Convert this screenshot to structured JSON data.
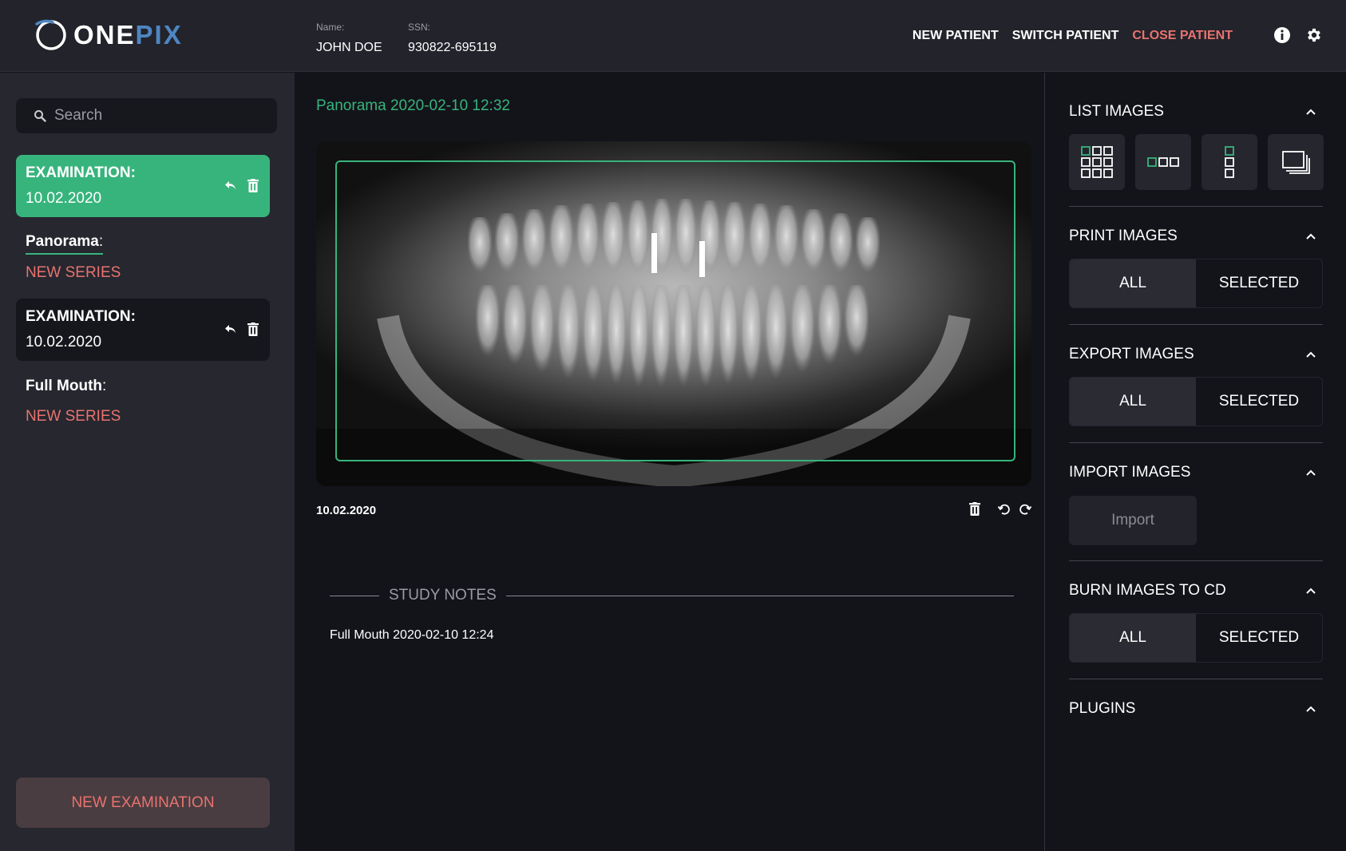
{
  "app": {
    "logo": {
      "one": "ONE",
      "pix": "PIX"
    }
  },
  "patient": {
    "name_label": "Name:",
    "name": "JOHN DOE",
    "ssn_label": "SSN:",
    "ssn": "930822-695119"
  },
  "topnav": {
    "new_patient": "NEW PATIENT",
    "switch_patient": "SWITCH PATIENT",
    "close_patient": "CLOSE PATIENT",
    "info_icon": "info-icon",
    "settings_icon": "gear-icon"
  },
  "sidebar": {
    "search_placeholder": "Search",
    "examinations": [
      {
        "label": "EXAMINATION",
        "date": "10.02.2020",
        "active": true
      },
      {
        "label": "EXAMINATION",
        "date": "10.02.2020",
        "active": false
      }
    ],
    "series": [
      {
        "label": "Panorama",
        "new_series": "NEW SERIES"
      },
      {
        "label": "Full Mouth",
        "new_series": "NEW SERIES"
      }
    ],
    "new_examination": "NEW EXAMINATION"
  },
  "main": {
    "image_title": "Panorama 2020-02-10 12:32",
    "image_date": "10.02.2020",
    "study_notes_title": "STUDY NOTES",
    "study_notes_text": "Full Mouth 2020-02-10 12:24"
  },
  "right_panel": {
    "list_images": "LIST IMAGES",
    "print_images": "PRINT IMAGES",
    "export_images": "EXPORT IMAGES",
    "import_images": "IMPORT IMAGES",
    "burn_images": "BURN IMAGES TO CD",
    "plugins": "PLUGINS",
    "all": "ALL",
    "selected": "SELECTED",
    "import_button": "Import"
  },
  "colors": {
    "accent_green": "#37b47c",
    "accent_red": "#e8736f",
    "logo_blue": "#4e86c2"
  }
}
